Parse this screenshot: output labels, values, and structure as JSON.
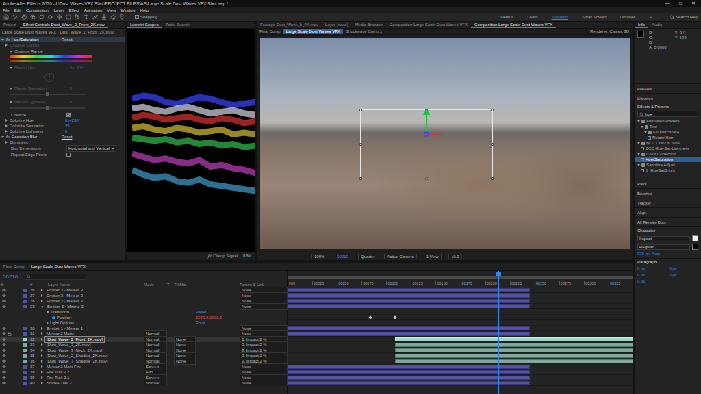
{
  "window": {
    "title": "Adobe After Effects 2020 - I:\\Dust Waves\\VFX Shot\\PROJECT FILES\\AE\\Large Scale Dust Waves VFX Shot.aep *",
    "controls": [
      "—",
      "□",
      "✕"
    ]
  },
  "menu": [
    "File",
    "Edit",
    "Composition",
    "Layer",
    "Effect",
    "Animation",
    "View",
    "Window",
    "Help"
  ],
  "toolbar": {
    "snapping": {
      "label": "Snapping",
      "checked": false
    },
    "workspaces": [
      {
        "label": "Default",
        "selected": false
      },
      {
        "label": "Learn",
        "selected": false
      },
      {
        "label": "Standard",
        "selected": true
      },
      {
        "label": "Small Screen",
        "selected": false
      },
      {
        "label": "Libraries",
        "selected": false
      }
    ],
    "more": "»",
    "search": "Search Help"
  },
  "effect_controls": {
    "tabs": [
      {
        "label": "Project",
        "selected": false
      },
      {
        "label": "Effect Controls Dust_Wave_2_Front_2K.mov",
        "selected": true
      }
    ],
    "subtitle": "Large Scale Dust Waves VFX · Dust_Wave_2_Front_2K.mov",
    "rows": [
      {
        "kind": "effect",
        "badge": "fx",
        "label": "Hue/Saturation",
        "value": "Reset",
        "selected": true,
        "expanded": true
      },
      {
        "kind": "label",
        "label": "Channel Control",
        "disabled": true
      },
      {
        "kind": "range",
        "label": "Channel Range"
      },
      {
        "kind": "dial",
        "label": "Master Hue",
        "value": "0x+0.0°",
        "disabled": true
      },
      {
        "kind": "slider",
        "label": "Master Saturation",
        "value": "0",
        "disabled": true,
        "level": 0.5
      },
      {
        "kind": "slider",
        "label": "Master Lightness",
        "value": "0",
        "disabled": true,
        "level": 0.5
      },
      {
        "kind": "checkbox",
        "label": "Colorize",
        "checked": true
      },
      {
        "kind": "value",
        "label": "Colorize Hue",
        "value": "0x+230°"
      },
      {
        "kind": "value",
        "label": "Colorize Saturation",
        "value": "35"
      },
      {
        "kind": "value",
        "label": "Colorize Lightness",
        "value": "0"
      },
      {
        "kind": "effect",
        "badge": "fx",
        "label": "Gaussian Blur",
        "value": "Reset",
        "selected": false,
        "expanded": true
      },
      {
        "kind": "label",
        "label": "Blurriness",
        "disabled": false
      },
      {
        "kind": "dropdown",
        "label": "Blur Dimensions",
        "value": "Horizontal and Vertical"
      },
      {
        "kind": "checkbox",
        "label": "Repeat Edge Pixels",
        "checked": false
      }
    ]
  },
  "scopes": {
    "tabs": [
      {
        "label": "Lumetri Scopes",
        "selected": true
      },
      {
        "label": "Table Search",
        "selected": false
      }
    ],
    "series": [
      {
        "color": "#3c45ff",
        "values": [
          82,
          84,
          83,
          80,
          79,
          81,
          83,
          82,
          80,
          78,
          79,
          80
        ]
      },
      {
        "color": "#d8d8e8",
        "values": [
          76,
          77,
          75,
          74,
          76,
          77,
          75,
          73,
          74,
          75,
          73,
          72
        ]
      },
      {
        "color": "#e03030",
        "values": [
          70,
          72,
          71,
          69,
          70,
          71,
          69,
          68,
          70,
          69,
          67,
          68
        ]
      },
      {
        "color": "#d8c030",
        "values": [
          64,
          65,
          63,
          62,
          64,
          63,
          61,
          62,
          63,
          60,
          61,
          60
        ]
      },
      {
        "color": "#30c050",
        "values": [
          58,
          57,
          56,
          57,
          55,
          56,
          54,
          55,
          53,
          54,
          52,
          53
        ]
      },
      {
        "color": "#c040c0",
        "values": [
          48,
          46,
          44,
          45,
          43,
          42,
          44,
          40,
          41,
          39,
          38,
          36
        ]
      },
      {
        "color": "#40a0d0",
        "values": [
          38,
          35,
          33,
          34,
          31,
          30,
          32,
          29,
          28,
          27,
          26,
          25
        ]
      }
    ],
    "clamp": "Clamp Signal",
    "bit_depth": "8 Bit"
  },
  "viewer": {
    "tabs": [
      {
        "label": "Footage Dust_Wave_b_4K.mov",
        "selected": false
      },
      {
        "label": "Layer (none)",
        "selected": false
      },
      {
        "label": "Media Browser",
        "selected": false
      },
      {
        "label": "Composition Large Scale Dust Waves VFX",
        "selected": false
      },
      {
        "label": "Composition Large Scale Dust Waves VFX",
        "selected": true
      }
    ],
    "breadcrumbs": [
      {
        "label": "Final Comp",
        "selected": false
      },
      {
        "label": "Large Scale Dust Waves VFX",
        "selected": true
      },
      {
        "label": "Shockwave Comp 1",
        "selected": false
      }
    ],
    "renderer": "Renderer: Classic 3D",
    "footer": [
      "100%",
      "00210",
      "Quarter",
      "Active Camera",
      "1 View",
      "+0.0"
    ]
  },
  "right": {
    "info": {
      "tabs": [
        {
          "label": "Info",
          "selected": true
        },
        {
          "label": "Audio",
          "selected": false
        }
      ],
      "color_lines": [
        "R:",
        "G:",
        "B:",
        "A: 0.0000"
      ],
      "pos_lines": [
        "X: 911",
        "Y: 633"
      ]
    },
    "panels_top": [
      "Preview",
      "Libraries"
    ],
    "effects": {
      "title": "Effects & Presets",
      "search": "hue",
      "tree": [
        {
          "kind": "folder",
          "label": "Animation Presets",
          "depth": 0,
          "expanded": true,
          "selected": false
        },
        {
          "kind": "folder",
          "label": "Text",
          "depth": 1,
          "expanded": true,
          "selected": false
        },
        {
          "kind": "folder",
          "label": "Fill and Stroke",
          "depth": 2,
          "expanded": true,
          "selected": false
        },
        {
          "kind": "item",
          "label": "Rotate Hue",
          "depth": 3,
          "selected": false
        },
        {
          "kind": "folder",
          "label": "BCC Color & Tone",
          "depth": 0,
          "expanded": true,
          "selected": false
        },
        {
          "kind": "item",
          "label": "BCC Hue-Sat-Lightness",
          "depth": 1,
          "selected": false
        },
        {
          "kind": "folder",
          "label": "Color Correction",
          "depth": 0,
          "expanded": true,
          "selected": false
        },
        {
          "kind": "item",
          "label": "Hue/Saturation",
          "depth": 1,
          "selected": true
        },
        {
          "kind": "folder",
          "label": "Sapphire Adjust",
          "depth": 0,
          "expanded": true,
          "selected": false
        },
        {
          "kind": "item",
          "label": "S_HueSatBright",
          "depth": 1,
          "selected": false
        }
      ]
    },
    "panels_mid": [
      "Paint",
      "Brushes",
      "Tracker",
      "Align",
      "All Render Bots"
    ],
    "character": {
      "title": "Character",
      "font": "Impact",
      "style": "Regular",
      "size": "379 px",
      "leading": "Auto"
    },
    "paragraph": {
      "title": "Paragraph",
      "values": [
        "0 px",
        "0 px",
        "0 px",
        "0 px",
        "0 px"
      ]
    }
  },
  "timeline": {
    "tabs": [
      {
        "label": "Final Comp",
        "selected": false
      },
      {
        "label": "Large Scale Dust Waves VFX",
        "selected": true
      }
    ],
    "timecode": "00210",
    "columns": [
      "#",
      "Layer Name",
      "Mode",
      "T",
      "TrkMat",
      "Parent & Link"
    ],
    "ruler": [
      "000",
      "00025",
      "00050",
      "00075",
      "00100",
      "00125",
      "00150",
      "00175",
      "00200",
      "00225",
      "00250",
      "00275",
      "00300",
      "00325"
    ],
    "playhead": 0.61,
    "rows": [
      {
        "kind": "layer",
        "number": "26",
        "name": "Emitter 3 - Meteor 3",
        "parent": "None",
        "color": "#5451a8",
        "bar_start": 0,
        "bar_end": 0.7,
        "selected": false,
        "expanded": false,
        "locked": false,
        "visible": true
      },
      {
        "kind": "layer",
        "number": "27",
        "name": "Emitter 3 - Meteor 3",
        "parent": "None",
        "color": "#5451a8",
        "bar_start": 0,
        "bar_end": 0.7,
        "selected": false,
        "expanded": false,
        "locked": false,
        "visible": true
      },
      {
        "kind": "layer",
        "number": "28",
        "name": "Emitter 3 - Meteor 3",
        "parent": "None",
        "color": "#5451a8",
        "bar_start": 0,
        "bar_end": 0.7,
        "selected": false,
        "expanded": false,
        "locked": false,
        "visible": true
      },
      {
        "kind": "layer",
        "number": "29",
        "name": "Emitter 3 - Meteor 2",
        "parent": "None",
        "color": "#5451a8",
        "bar_start": 0,
        "bar_end": 0.7,
        "selected": false,
        "expanded": true,
        "locked": false,
        "visible": true
      },
      {
        "kind": "property",
        "label": "Transform",
        "value": "Reset",
        "depth": 1,
        "expanded": true,
        "animated": false,
        "keyframes": []
      },
      {
        "kind": "property",
        "label": "Position",
        "value": "2870.9,2000.2",
        "depth": 2,
        "expanded": false,
        "animated": true,
        "keyframes": [
          0.24,
          0.31
        ]
      },
      {
        "kind": "property",
        "label": "Light Options",
        "value": "Point",
        "depth": 1,
        "expanded": false,
        "animated": false,
        "keyframes": []
      },
      {
        "kind": "layer",
        "number": "30",
        "name": "Emitter 1 - Meteor 1",
        "parent": "None",
        "color": "#5451a8",
        "bar_start": 0,
        "bar_end": 0.7,
        "selected": false,
        "expanded": false,
        "locked": false,
        "visible": true
      },
      {
        "kind": "layer",
        "number": "31",
        "name": "Meteor 2 Matte",
        "mode": "Normal",
        "parent": "None",
        "color": "#5451a8",
        "bar_start": 0,
        "bar_end": 0.7,
        "selected": false,
        "expanded": false,
        "locked": true,
        "visible": true
      },
      {
        "kind": "layer",
        "number": "32",
        "name": "[Dust_Wave_2_Front_2K.mov]",
        "mode": "Normal",
        "trkmat": "None",
        "parent": "3. Impact 2 %",
        "color": "#9fd6c6",
        "bar_start": 0.31,
        "bar_end": 1,
        "selected": true,
        "expanded": false,
        "locked": false,
        "visible": true
      },
      {
        "kind": "layer",
        "number": "33",
        "name": "[Dust_Wave_7_2K.mov]",
        "mode": "Normal",
        "trkmat": "None",
        "parent": "3. Impact 2 %",
        "color": "#7fa99c",
        "bar_start": 0.31,
        "bar_end": 1,
        "selected": false,
        "expanded": false,
        "locked": false,
        "visible": true
      },
      {
        "kind": "layer",
        "number": "34",
        "name": "[Dust_Wave_3_Neck_2K.mov]",
        "mode": "Normal",
        "trkmat": "None",
        "parent": "3. Impact 2 %",
        "color": "#7fa99c",
        "bar_start": 0.31,
        "bar_end": 1,
        "selected": false,
        "expanded": false,
        "locked": false,
        "visible": true
      },
      {
        "kind": "layer",
        "number": "35",
        "name": "[Dust_Wave_2_Shadow_2K.mov]",
        "mode": "Normal",
        "trkmat": "None",
        "parent": "3. Impact 2 %",
        "color": "#7fa99c",
        "bar_start": 0.31,
        "bar_end": 1,
        "selected": false,
        "expanded": false,
        "locked": false,
        "visible": true
      },
      {
        "kind": "layer",
        "number": "36",
        "name": "[Dust_Wave_7_Shadow_2K.mov]",
        "mode": "Normal",
        "trkmat": "None",
        "parent": "3. Impact 2 %",
        "color": "#7fa99c",
        "bar_start": 0.31,
        "bar_end": 1,
        "selected": false,
        "expanded": false,
        "locked": false,
        "visible": true
      },
      {
        "kind": "layer",
        "number": "37",
        "name": "Meteor 2 Main Fire",
        "mode": "Screen",
        "parent": "None",
        "color": "#5451a8",
        "bar_start": 0,
        "bar_end": 0.7,
        "selected": false,
        "expanded": false,
        "locked": false,
        "visible": true
      },
      {
        "kind": "layer",
        "number": "38",
        "name": "Fire Trail 2.2",
        "mode": "Add",
        "parent": "None",
        "color": "#5451a8",
        "bar_start": 0,
        "bar_end": 0.7,
        "selected": false,
        "expanded": false,
        "locked": false,
        "visible": true
      },
      {
        "kind": "layer",
        "number": "39",
        "name": "Fire Trail 2.1",
        "mode": "Screen",
        "parent": "None",
        "color": "#5451a8",
        "bar_start": 0,
        "bar_end": 0.7,
        "selected": false,
        "expanded": false,
        "locked": false,
        "visible": true
      },
      {
        "kind": "layer",
        "number": "40",
        "name": "Smoke Trail 2",
        "mode": "Normal",
        "parent": "None",
        "color": "#5451a8",
        "bar_start": 0,
        "bar_end": 0.7,
        "selected": false,
        "expanded": false,
        "locked": false,
        "visible": true
      }
    ]
  }
}
